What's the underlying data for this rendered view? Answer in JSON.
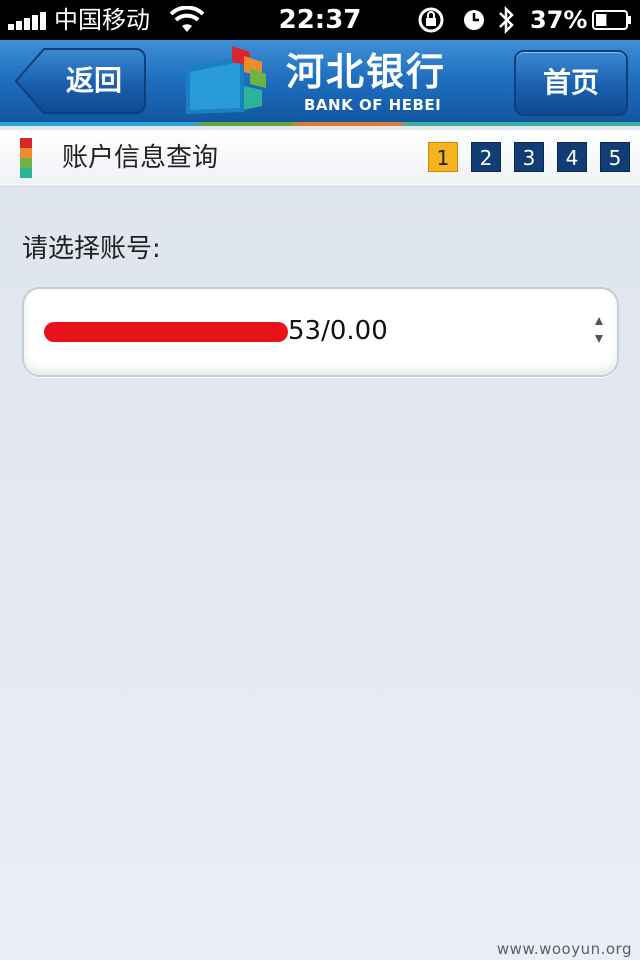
{
  "status_bar": {
    "carrier": "中国移动",
    "time": "22:37",
    "battery_percent": "37%",
    "battery_level": 0.37,
    "icons": [
      "signal-icon",
      "wifi-icon",
      "rotation-lock-icon",
      "alarm-icon",
      "bluetooth-icon",
      "battery-icon"
    ]
  },
  "nav": {
    "back_label": "返回",
    "home_label": "首页",
    "logo_cn": "河北银行",
    "logo_en": "BANK OF HEBEI"
  },
  "title_bar": {
    "title": "账户信息查询",
    "steps": [
      "1",
      "2",
      "3",
      "4",
      "5"
    ],
    "active_step": "1"
  },
  "form": {
    "prompt": "请选择账号:",
    "account_value_visible": "53/0.00"
  },
  "watermark": "www.wooyun.org",
  "colors": {
    "nav_blue": "#1f6fbf",
    "step_blue": "#123c74",
    "step_active": "#f3b41f",
    "redaction": "#e8131a"
  }
}
